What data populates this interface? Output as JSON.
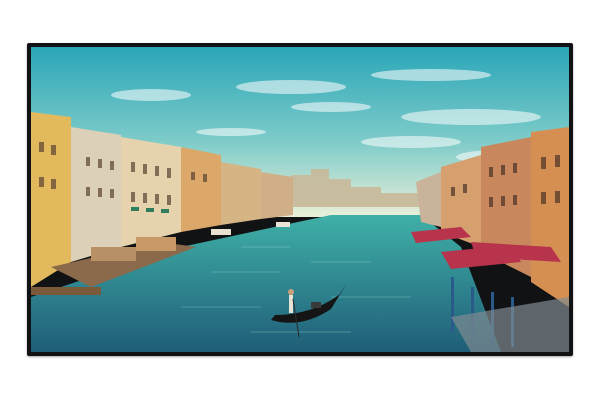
{
  "scene": {
    "subject": "grand-canal-venice-on-display",
    "colors": {
      "sky_top": "#2aa6b8",
      "sky_mid": "#7dcbc9",
      "sky_horizon": "#e9efd8",
      "water_far": "#3fb0a7",
      "water_near": "#1f5d78",
      "building_warm": "#d58f52",
      "building_cream": "#e8c98f",
      "awning_red": "#b8344c",
      "frame": "#111214"
    }
  }
}
